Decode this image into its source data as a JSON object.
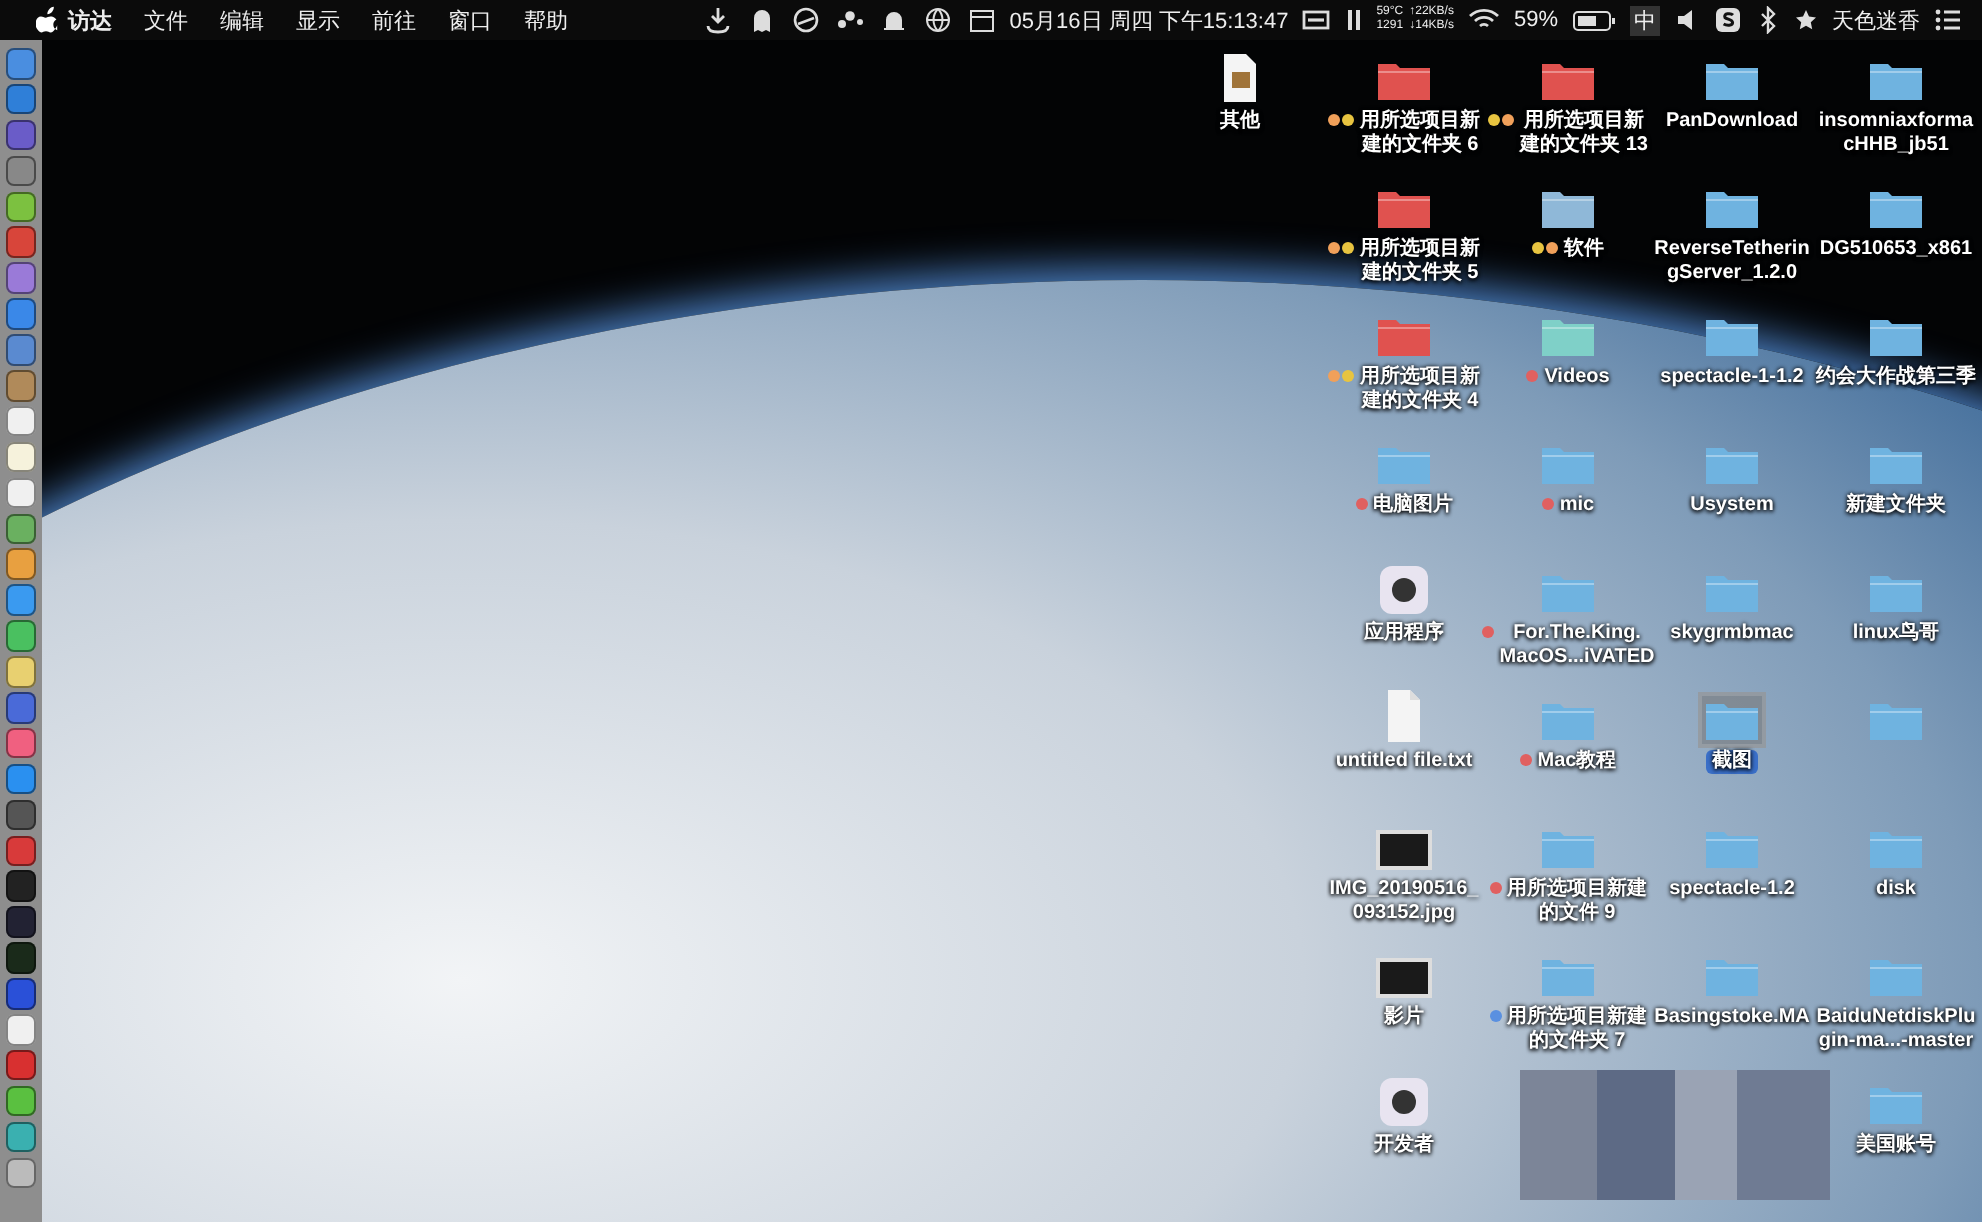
{
  "menu_bar": {
    "app_name": "访达",
    "menus": [
      "文件",
      "编辑",
      "显示",
      "前往",
      "窗口",
      "帮助"
    ],
    "clock": "05月16日 周四 下午15:13:47",
    "sensor": {
      "temperature": "59°C",
      "upload": "↑22KB/s",
      "fan": "1291",
      "download": "↓14KB/s"
    },
    "battery": "59%",
    "input_method": "中",
    "user": "天色迷香"
  },
  "desktop": {
    "rows": [
      [
        {
          "kind": "file",
          "label": [
            "其他"
          ],
          "selected": false
        },
        {
          "kind": "folder",
          "color": "#e0524f",
          "label": [
            "用所选项目新",
            "建的文件夹 6"
          ],
          "tags": [
            {
              "color": "#f0a05a"
            },
            {
              "color": "#e8c440"
            }
          ],
          "selected": false
        },
        {
          "kind": "folder",
          "color": "#e0524f",
          "label": [
            "用所选项目新",
            "建的文件夹 13"
          ],
          "tags": [
            {
              "color": "#e8c440"
            },
            {
              "color": "#f0a05a"
            }
          ],
          "selected": false
        },
        {
          "kind": "folder",
          "color": "#6fb3e0",
          "label": [
            "PanDownload"
          ],
          "selected": false
        },
        {
          "kind": "folder",
          "color": "#6fb3e0",
          "label": [
            "insomniaxforma",
            "cHHB_jb51"
          ],
          "selected": false
        }
      ],
      [
        null,
        {
          "kind": "folder",
          "color": "#e0524f",
          "label": [
            "用所选项目新",
            "建的文件夹 5"
          ],
          "tags": [
            {
              "color": "#f0a05a"
            },
            {
              "color": "#e8c440"
            }
          ],
          "selected": false
        },
        {
          "kind": "folder",
          "color": "#8fb8d8",
          "label": [
            "软件"
          ],
          "tags": [
            {
              "color": "#e8c440"
            },
            {
              "color": "#f0a05a"
            }
          ],
          "selected": false
        },
        {
          "kind": "folder",
          "color": "#6fb3e0",
          "label": [
            "ReverseTetherin",
            "gServer_1.2.0"
          ],
          "selected": false
        },
        {
          "kind": "folder",
          "color": "#6fb3e0",
          "label": [
            "DG510653_x861"
          ],
          "selected": false
        }
      ],
      [
        null,
        {
          "kind": "folder",
          "color": "#e0524f",
          "label": [
            "用所选项目新",
            "建的文件夹 4"
          ],
          "tags": [
            {
              "color": "#f0a05a"
            },
            {
              "color": "#e8c440"
            }
          ],
          "selected": false
        },
        {
          "kind": "folder",
          "color": "#7fd0c8",
          "label": [
            "Videos"
          ],
          "tags": [
            {
              "color": "#e06060"
            }
          ],
          "selected": false
        },
        {
          "kind": "folder",
          "color": "#6fb3e0",
          "label": [
            "spectacle-1-1.2"
          ],
          "selected": false
        },
        {
          "kind": "folder",
          "color": "#6fb3e0",
          "label": [
            "约会大作战第三季"
          ],
          "selected": false
        }
      ],
      [
        null,
        {
          "kind": "folder",
          "color": "#6fb3e0",
          "label": [
            "电脑图片"
          ],
          "tags": [
            {
              "color": "#e06060"
            }
          ],
          "selected": false
        },
        {
          "kind": "folder",
          "color": "#6fb3e0",
          "label": [
            "mic"
          ],
          "tags": [
            {
              "color": "#e06060"
            }
          ],
          "selected": false
        },
        {
          "kind": "folder",
          "color": "#6fb3e0",
          "label": [
            "Usystem"
          ],
          "selected": false
        },
        {
          "kind": "folder",
          "color": "#6fb3e0",
          "label": [
            "新建文件夹"
          ],
          "selected": false
        }
      ],
      [
        null,
        {
          "kind": "app",
          "label": [
            "应用程序"
          ],
          "selected": false
        },
        {
          "kind": "folder",
          "color": "#6fb3e0",
          "label": [
            "For.The.King.",
            "MacOS...iVATED"
          ],
          "tags": [
            {
              "color": "#e06060"
            }
          ],
          "selected": false
        },
        {
          "kind": "folder",
          "color": "#6fb3e0",
          "label": [
            "skygrmbmac"
          ],
          "selected": false
        },
        {
          "kind": "folder",
          "color": "#6fb3e0",
          "label": [
            "linux鸟哥"
          ],
          "selected": false
        }
      ],
      [
        null,
        {
          "kind": "document",
          "label": [
            "untitled file.txt"
          ],
          "selected": false
        },
        {
          "kind": "folder",
          "color": "#6fb3e0",
          "label": [
            "Mac教程"
          ],
          "tags": [
            {
              "color": "#e06060"
            }
          ],
          "selected": false
        },
        {
          "kind": "folder",
          "color": "#6fb3e0",
          "label": [
            "截图"
          ],
          "selected": true
        },
        {
          "kind": "folder",
          "color": "#6fb3e0",
          "selected": false
        }
      ],
      [
        null,
        {
          "kind": "image",
          "label": [
            "IMG_20190516_",
            "093152.jpg"
          ],
          "selected": false
        },
        {
          "kind": "folder",
          "color": "#6fb3e0",
          "label": [
            "用所选项目新建",
            "的文件 9"
          ],
          "tags": [
            {
              "color": "#e06060"
            }
          ],
          "selected": false
        },
        {
          "kind": "folder",
          "color": "#6fb3e0",
          "label": [
            "spectacle-1.2"
          ],
          "selected": false
        },
        {
          "kind": "folder",
          "color": "#6fb3e0",
          "label": [
            "disk"
          ],
          "selected": false
        }
      ],
      [
        null,
        {
          "kind": "image",
          "label": [
            "影片"
          ],
          "selected": false
        },
        {
          "kind": "folder",
          "color": "#6fb3e0",
          "label": [
            "用所选项目新建",
            "的文件夹 7"
          ],
          "tags": [
            {
              "color": "#5a90e0"
            }
          ],
          "selected": false
        },
        {
          "kind": "folder",
          "color": "#6fb3e0",
          "label": [
            "Basingstoke.MA"
          ],
          "selected": false
        },
        {
          "kind": "folder",
          "color": "#6fb3e0",
          "label": [
            "BaiduNetdiskPlu",
            "gin-ma...-master"
          ],
          "selected": false
        }
      ],
      [
        null,
        {
          "kind": "app",
          "label": [
            "开发者"
          ],
          "selected": false
        },
        null,
        null,
        {
          "kind": "folder",
          "color": "#6fb3e0",
          "label": [
            "美国账号"
          ],
          "selected": false
        }
      ]
    ]
  }
}
